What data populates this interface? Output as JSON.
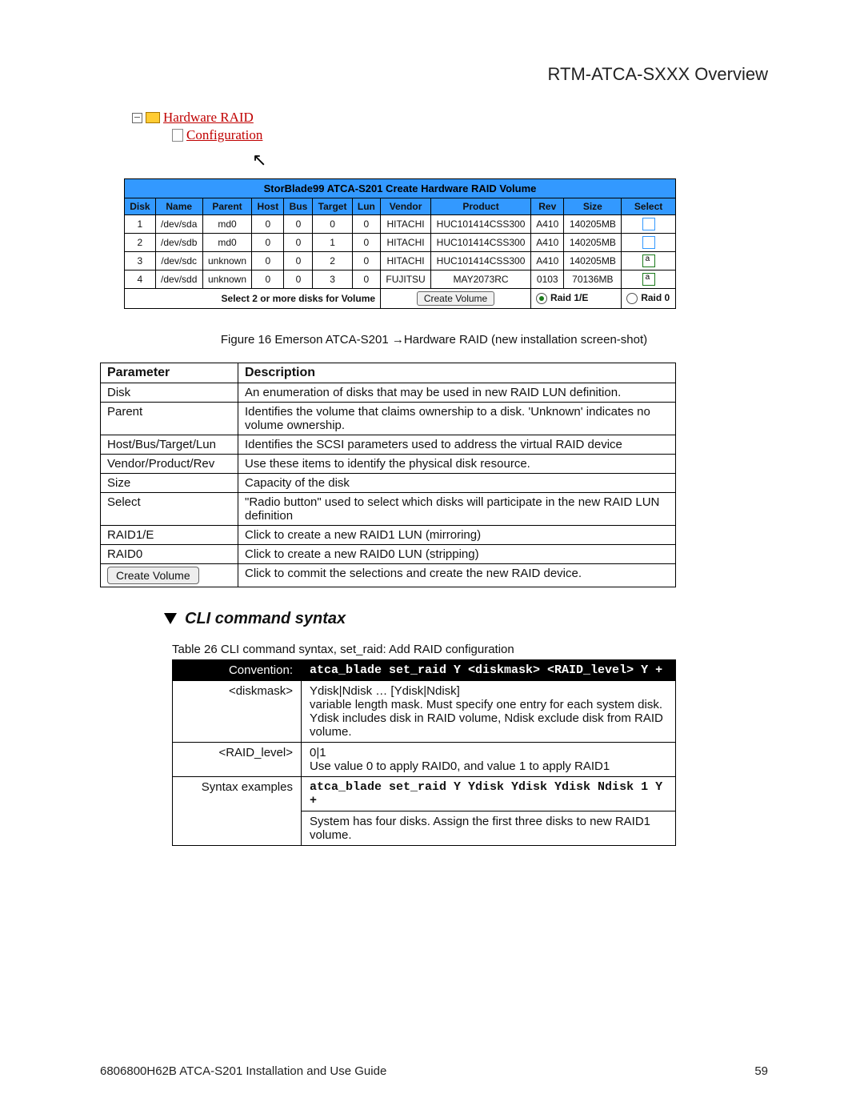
{
  "header": {
    "title": "RTM-ATCA-SXXX Overview"
  },
  "tree": {
    "hardware_raid": "Hardware RAID",
    "configuration": "Configuration"
  },
  "raid_table": {
    "title": "StorBlade99 ATCA-S201 Create Hardware RAID Volume",
    "cols": [
      "Disk",
      "Name",
      "Parent",
      "Host",
      "Bus",
      "Target",
      "Lun",
      "Vendor",
      "Product",
      "Rev",
      "Size",
      "Select"
    ],
    "rows": [
      {
        "disk": "1",
        "name": "/dev/sda",
        "parent": "md0",
        "host": "0",
        "bus": "0",
        "target": "0",
        "lun": "0",
        "vendor": "HITACHI",
        "product": "HUC101414CSS300",
        "rev": "A410",
        "size": "140205MB",
        "sel": "blue"
      },
      {
        "disk": "2",
        "name": "/dev/sdb",
        "parent": "md0",
        "host": "0",
        "bus": "0",
        "target": "1",
        "lun": "0",
        "vendor": "HITACHI",
        "product": "HUC101414CSS300",
        "rev": "A410",
        "size": "140205MB",
        "sel": "blue"
      },
      {
        "disk": "3",
        "name": "/dev/sdc",
        "parent": "unknown",
        "host": "0",
        "bus": "0",
        "target": "2",
        "lun": "0",
        "vendor": "HITACHI",
        "product": "HUC101414CSS300",
        "rev": "A410",
        "size": "140205MB",
        "sel": "green"
      },
      {
        "disk": "4",
        "name": "/dev/sdd",
        "parent": "unknown",
        "host": "0",
        "bus": "0",
        "target": "3",
        "lun": "0",
        "vendor": "FUJITSU",
        "product": "MAY2073RC",
        "rev": "0103",
        "size": "70136MB",
        "sel": "green"
      }
    ],
    "footer": {
      "select_text": "Select 2 or more disks for Volume",
      "create_btn": "Create Volume",
      "raid1": "Raid 1/E",
      "raid0": "Raid 0"
    }
  },
  "figure_caption": "Figure 16  Emerson ATCA-S201 →Hardware RAID (new installation screen-shot)",
  "params_table": {
    "headers": [
      "Parameter",
      "Description"
    ],
    "rows": [
      {
        "p": "Disk",
        "d": "An enumeration of disks that may be used in new RAID LUN definition."
      },
      {
        "p": "Parent",
        "d": "Identifies the volume that claims ownership to a disk. 'Unknown' indicates no volume ownership."
      },
      {
        "p": "Host/Bus/Target/Lun",
        "d": "Identifies the SCSI parameters used to address the virtual RAID device"
      },
      {
        "p": "Vendor/Product/Rev",
        "d": "Use these items to identify the physical disk resource."
      },
      {
        "p": "Size",
        "d": "Capacity of the disk"
      },
      {
        "p": "Select",
        "d": "\"Radio button\" used to select which disks will participate in the new RAID LUN definition"
      },
      {
        "p": "RAID1/E",
        "d": "Click to create a new RAID1 LUN (mirroring)"
      },
      {
        "p": "RAID0",
        "d": "Click to create a new RAID0 LUN (stripping)"
      },
      {
        "p_btn": "Create Volume",
        "d": "Click to commit the selections and create the new RAID device."
      }
    ]
  },
  "cli_heading": "CLI command syntax",
  "cli_caption": "Table 26 CLI command syntax, set_raid: Add RAID configuration",
  "cli_table": {
    "conv_label": "Convention:",
    "conv_value": "atca_blade set_raid Y <diskmask> <RAID_level> Y +",
    "diskmask_label": "<diskmask>",
    "diskmask_lines": [
      "Ydisk|Ndisk … [Ydisk|Ndisk]",
      "variable length mask. Must specify one entry for each system disk.",
      "Ydisk includes disk in RAID volume, Ndisk exclude disk from RAID volume."
    ],
    "raidlevel_label": "<RAID_level>",
    "raidlevel_lines": [
      "0|1",
      "Use value 0 to apply RAID0, and value 1  to apply RAID1"
    ],
    "syntax_label": "Syntax examples",
    "syntax_value": "atca_blade set_raid Y Ydisk Ydisk Ydisk Ndisk 1 Y +",
    "syntax_desc": "System has four disks.  Assign the first three disks to new RAID1 volume."
  },
  "footer": {
    "left": "6806800H62B ATCA-S201 Installation and Use Guide",
    "right": "59"
  }
}
